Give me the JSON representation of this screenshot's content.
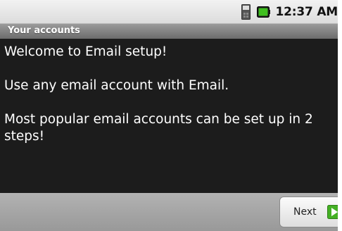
{
  "status_bar": {
    "time": "12:37 AM",
    "icons": [
      "sim-card-icon",
      "battery-icon"
    ],
    "battery_color": "#3fbf1f"
  },
  "title_bar": {
    "title": "Your accounts"
  },
  "content": {
    "welcome": "Welcome to Email setup!",
    "use_any": "Use any email account with Email.",
    "popular": "Most popular email accounts can be set up in 2 steps!"
  },
  "bottom_bar": {
    "next_label": "Next",
    "next_icon": "arrow-right-icon",
    "next_icon_color": "#44b024"
  }
}
